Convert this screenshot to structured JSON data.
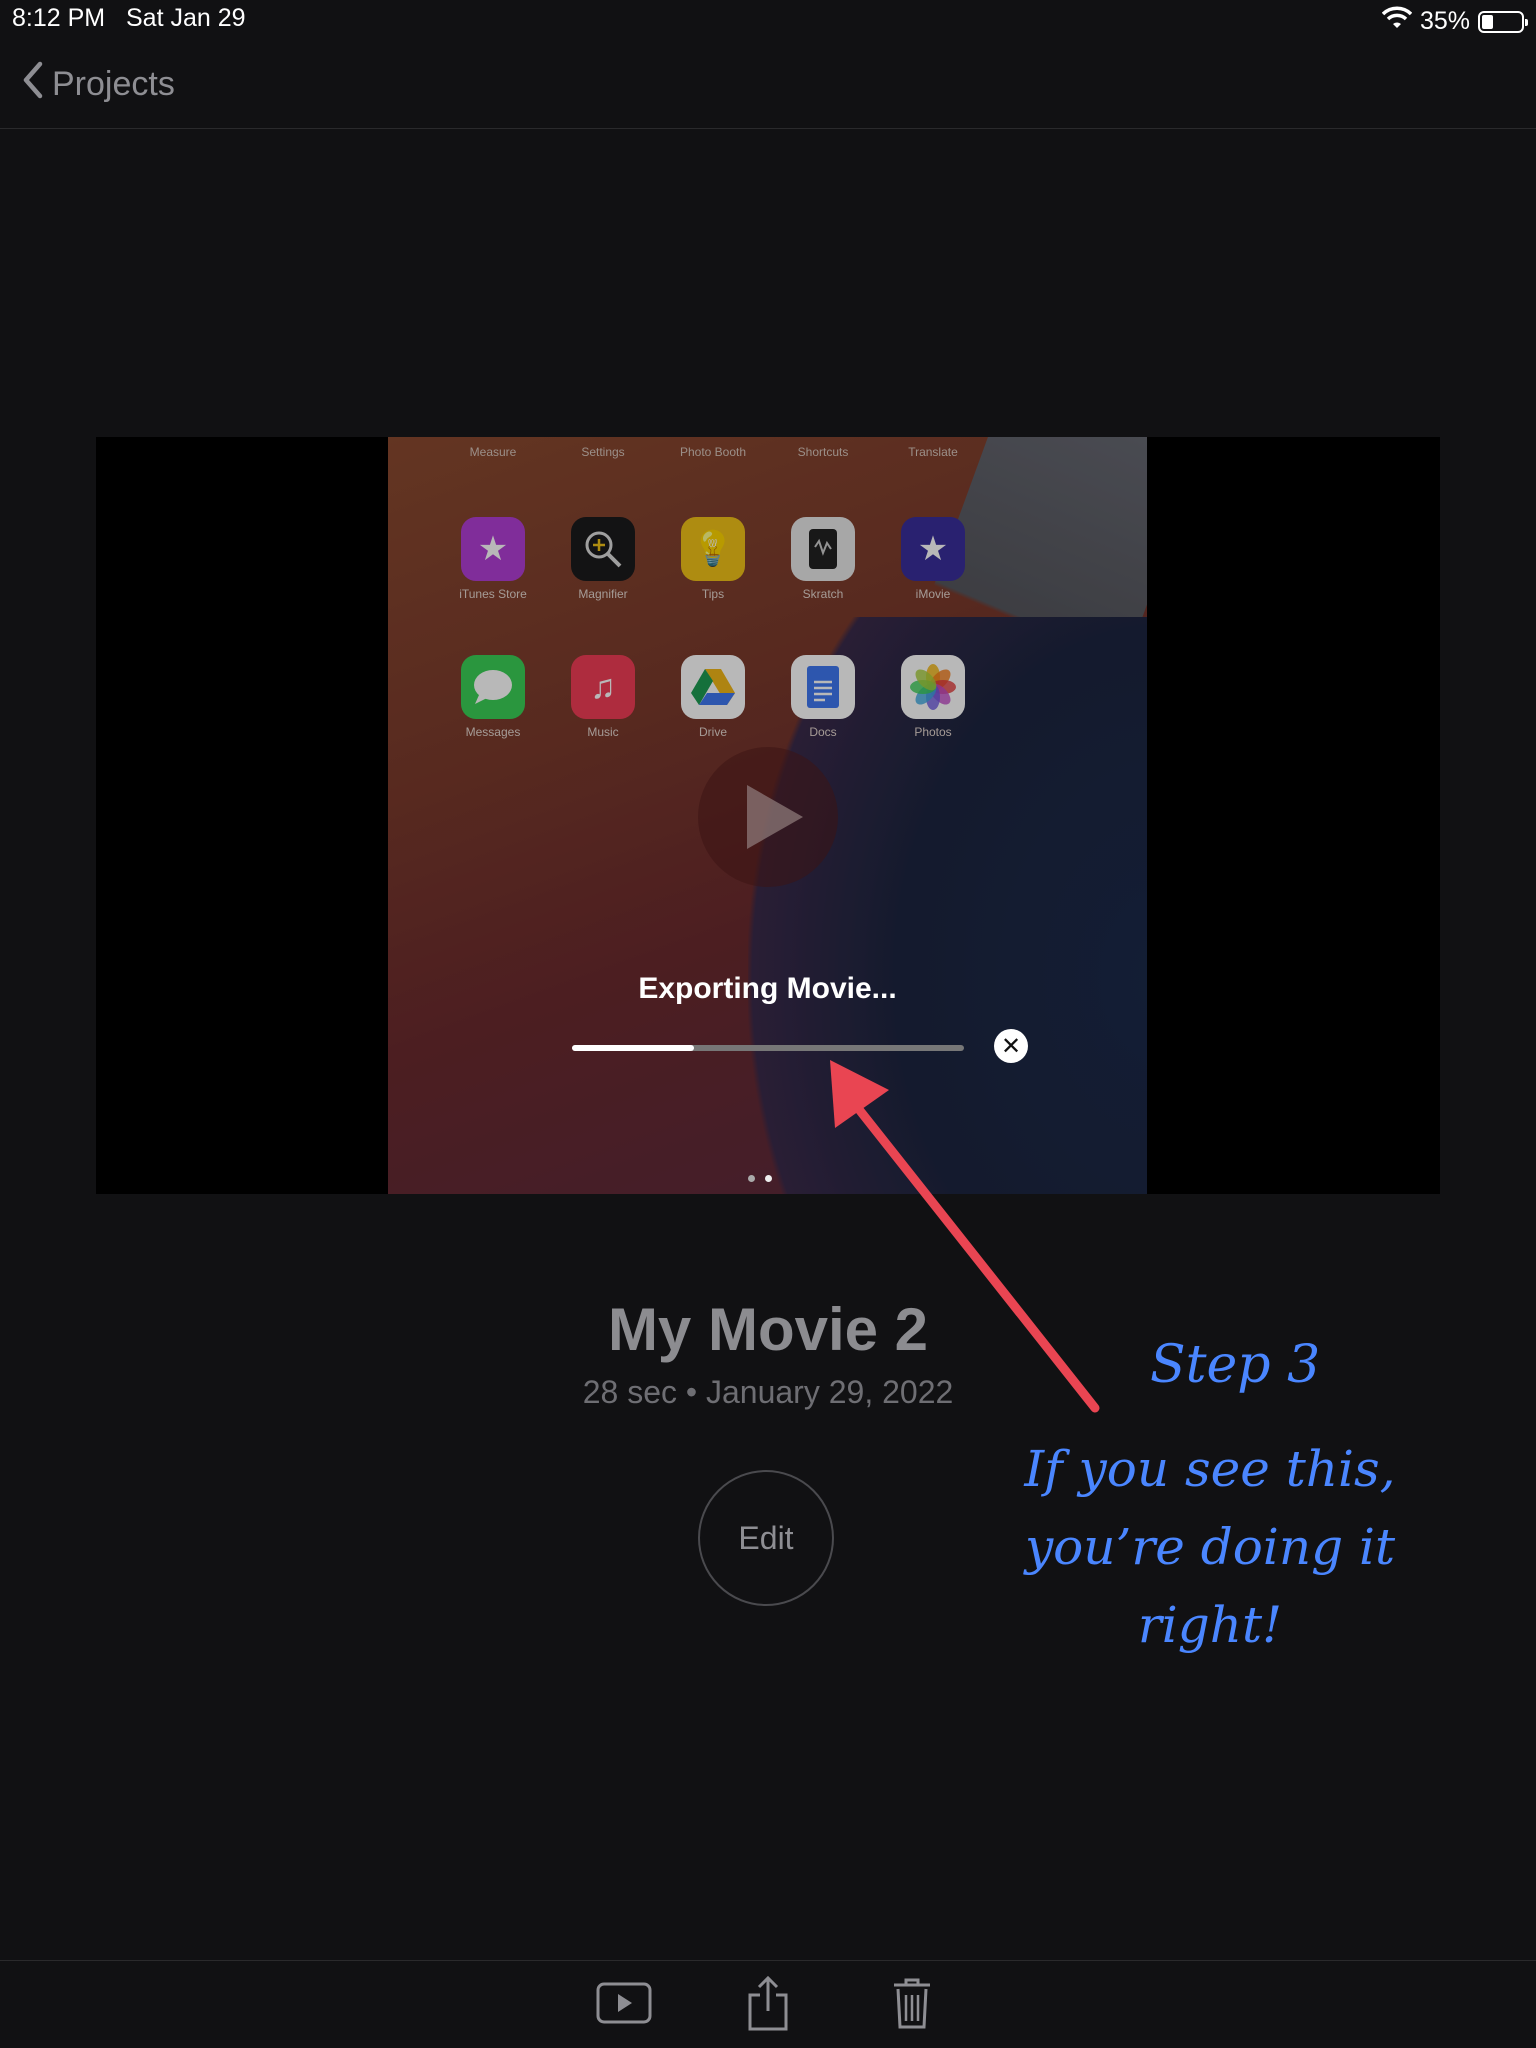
{
  "status_bar": {
    "time": "8:12 PM",
    "date": "Sat Jan 29",
    "battery": "35%",
    "battery_level": 0.35
  },
  "nav": {
    "back_label": "Projects"
  },
  "preview": {
    "top_row_labels": [
      "Measure",
      "Settings",
      "Photo Booth",
      "Shortcuts",
      "Translate"
    ],
    "apps_row1": [
      {
        "label": "iTunes Store",
        "icon": "star-icon",
        "color": "#b23fd6"
      },
      {
        "label": "Magnifier",
        "icon": "magnifier-icon",
        "color": "#1b1b1d"
      },
      {
        "label": "Tips",
        "icon": "lightbulb-icon",
        "color": "#f2c318"
      },
      {
        "label": "Skratch",
        "icon": "skratch-icon",
        "color": "#e8e8e8"
      },
      {
        "label": "iMovie",
        "icon": "imovie-star-icon",
        "color": "#3a2f9c"
      }
    ],
    "apps_row2": [
      {
        "label": "Messages",
        "icon": "message-bubble-icon",
        "color": "#3bd057"
      },
      {
        "label": "Music",
        "icon": "music-note-icon",
        "color": "#f23d57"
      },
      {
        "label": "Drive",
        "icon": "google-drive-icon",
        "color": "#ffffff"
      },
      {
        "label": "Docs",
        "icon": "google-docs-icon",
        "color": "#3f78f2"
      },
      {
        "label": "Photos",
        "icon": "photos-flower-icon",
        "color": "#ffffff"
      }
    ],
    "export_label": "Exporting Movie...",
    "progress": 0.31
  },
  "project": {
    "title": "My Movie 2",
    "meta": "28 sec • January 29, 2022",
    "edit_label": "Edit"
  },
  "annotation": {
    "step": "Step 3",
    "text": "If you see this, you’re doing it right!",
    "color": "#4a86ff",
    "arrow_color": "#e94552"
  },
  "toolbar": {
    "play_icon": "play-icon",
    "share_icon": "share-icon",
    "trash_icon": "trash-icon"
  }
}
